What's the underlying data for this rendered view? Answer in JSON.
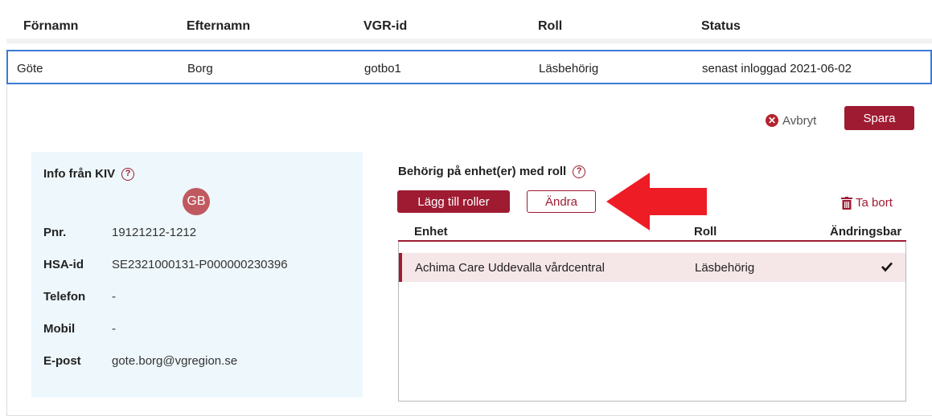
{
  "table": {
    "headers": [
      "Förnamn",
      "Efternamn",
      "VGR-id",
      "Roll",
      "Status"
    ],
    "row": {
      "firstname": "Göte",
      "lastname": "Borg",
      "vgr_id": "gotbo1",
      "role": "Läsbehörig",
      "status": "senast inloggad 2021-06-02"
    }
  },
  "actions": {
    "cancel_label": "Avbryt",
    "save_label": "Spara"
  },
  "kiv": {
    "title": "Info från KIV",
    "avatar_initials": "GB",
    "fields": [
      {
        "label": "Pnr.",
        "value": "19121212-1212"
      },
      {
        "label": "HSA-id",
        "value": "SE2321000131-P000000230396"
      },
      {
        "label": "Telefon",
        "value": "-"
      },
      {
        "label": "Mobil",
        "value": "-"
      },
      {
        "label": "E-post",
        "value": "gote.borg@vgregion.se"
      }
    ]
  },
  "roles": {
    "title": "Behörig på enhet(er) med roll",
    "add_label": "Lägg till roller",
    "edit_label": "Ändra",
    "remove_label": "Ta bort",
    "columns": [
      "Enhet",
      "Roll",
      "Ändringsbar"
    ],
    "rows": [
      {
        "unit": "Achima Care Uddevalla vårdcentral",
        "role": "Läsbehörig",
        "editable": true
      }
    ]
  },
  "icons": {
    "help": "help-circle-icon",
    "cancel": "close-circle-icon",
    "remove": "trash-icon",
    "check": "check-icon",
    "arrow": "arrow-left-icon"
  },
  "colors": {
    "brand": "#9e1b32",
    "selection": "#3a7bd5",
    "info_bg": "#eef7fb",
    "row_highlight": "#f5e6e8",
    "arrow": "#ee1c24"
  }
}
